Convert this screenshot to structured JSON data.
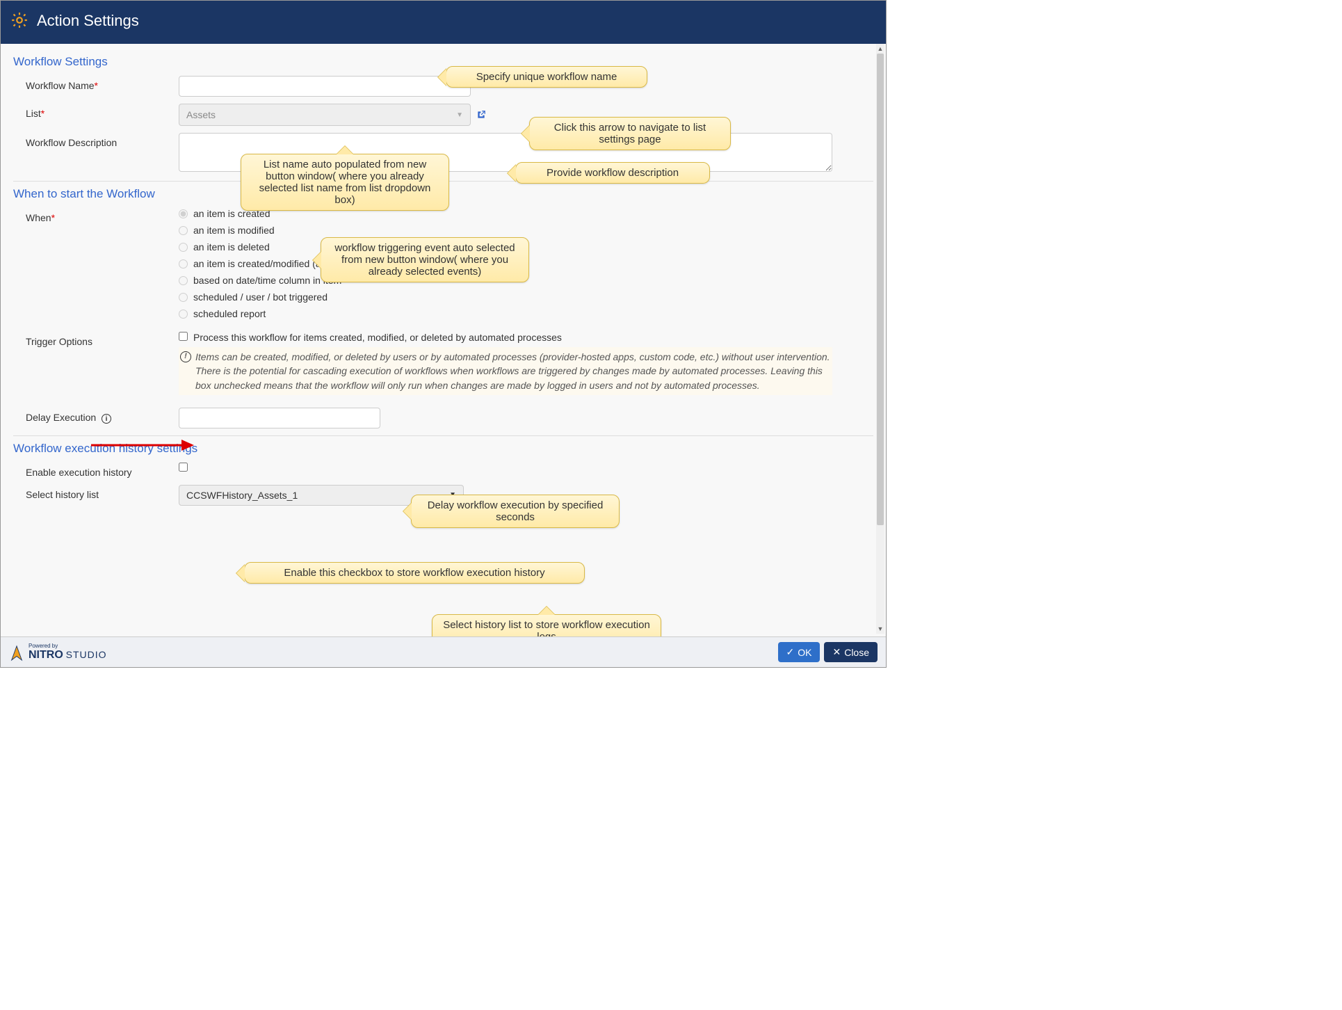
{
  "header": {
    "title": "Action Settings"
  },
  "sections": {
    "workflow_settings": {
      "title": "Workflow Settings",
      "name_label": "Workflow Name",
      "name_value": "",
      "list_label": "List",
      "list_value": "Assets",
      "desc_label": "Workflow Description",
      "desc_value": ""
    },
    "when": {
      "title": "When to start the Workflow",
      "when_label": "When",
      "options": [
        "an item is created",
        "an item is modified",
        "an item is deleted",
        "an item is created/modified (async)",
        "based on date/time column in item",
        "scheduled / user / bot triggered",
        "scheduled report"
      ],
      "selected_index": 0,
      "trigger_label": "Trigger Options",
      "trigger_checkbox": "Process this workflow for items created, modified, or deleted by automated processes",
      "trigger_hint": "Items can be created, modified, or deleted by users or by automated processes (provider-hosted apps, custom code, etc.) without user intervention. There is the potential for cascading execution of workflows when workflows are triggered by changes made by automated processes. Leaving this box unchecked means that the workflow will only run when changes are made by logged in users and not by automated processes.",
      "delay_label": "Delay Execution",
      "delay_value": ""
    },
    "history": {
      "title": "Workflow execution history settings",
      "enable_label": "Enable execution history",
      "select_label": "Select history list",
      "select_value": "CCSWFHistory_Assets_1"
    }
  },
  "callouts": {
    "name": "Specify unique workflow name",
    "list_nav": "Click this arrow to navigate to list settings page",
    "list_auto": "List name auto populated from new button window( where you already selected list name from list dropdown box)",
    "desc": "Provide workflow description",
    "when_auto": "workflow triggering event auto selected from new button window( where you already selected events)",
    "delay": "Delay workflow execution by specified seconds",
    "enable_hist": "Enable this checkbox to store workflow execution history",
    "select_hist": "Select history list to store workflow execution logs"
  },
  "footer": {
    "brand_powered": "Powered by",
    "brand_name": "NITRO",
    "brand_sub": "STUDIO",
    "ok": "OK",
    "close": "Close"
  }
}
